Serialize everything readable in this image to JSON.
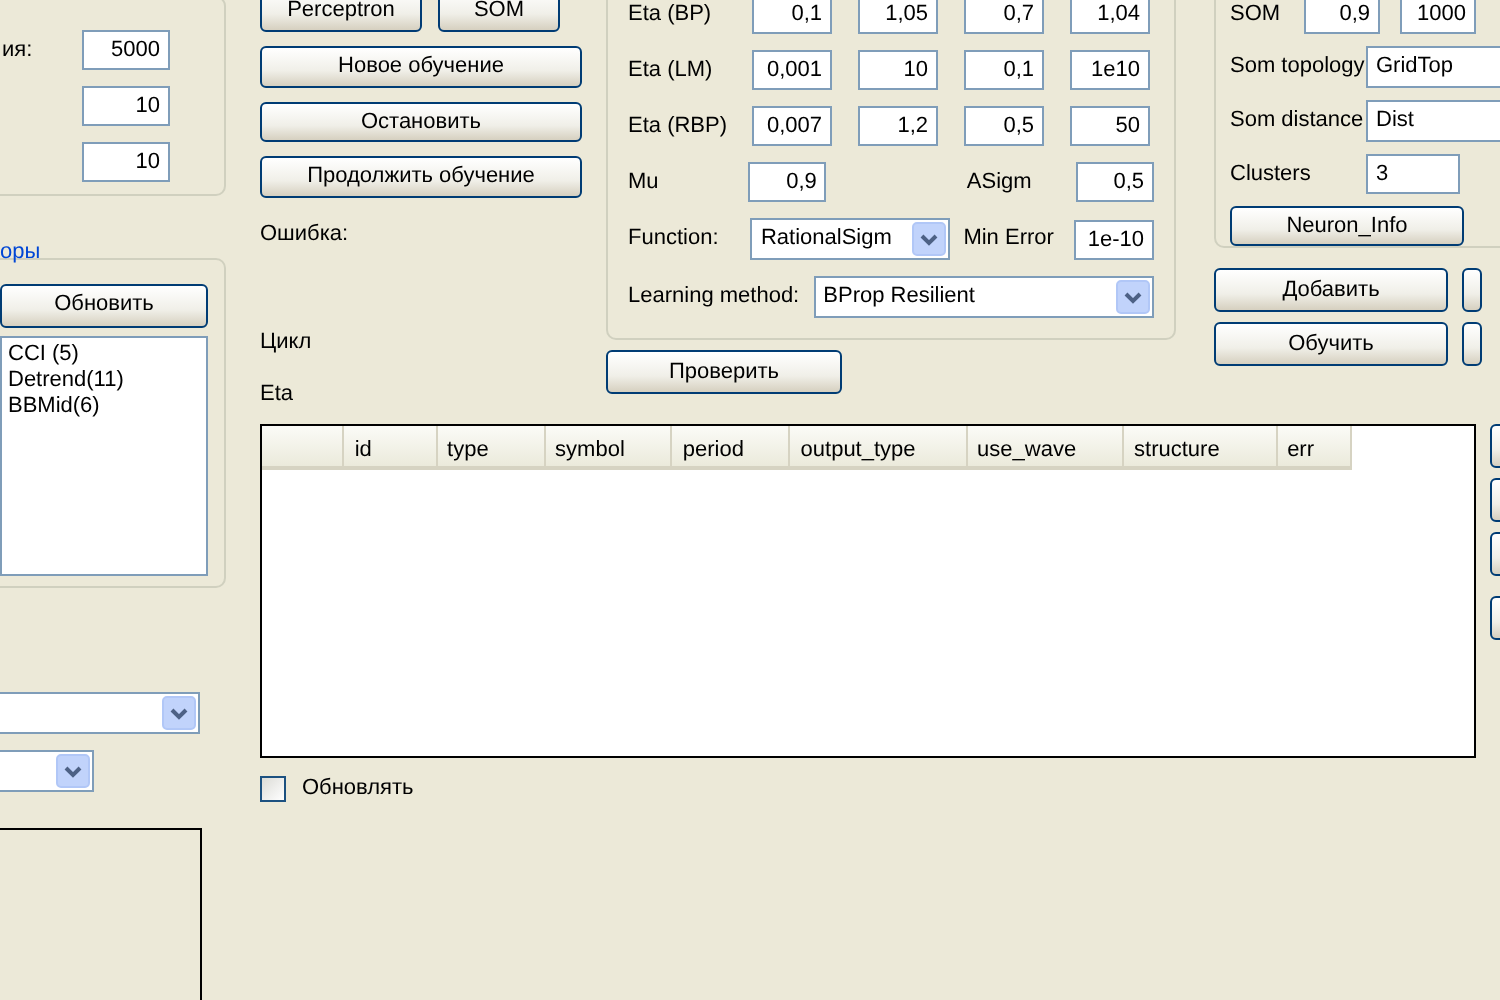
{
  "left_panel": {
    "fields": [
      {
        "label": "ия:",
        "value": "5000"
      },
      {
        "value": "10"
      },
      {
        "value": "10"
      }
    ],
    "indicators_group": {
      "title": "оры",
      "refresh_button": "Обновить",
      "items": [
        "CCI (5)",
        "Detrend(11)",
        "BBMid(6)"
      ]
    }
  },
  "model_buttons": [
    "Perceptron",
    "SOM"
  ],
  "training_buttons": [
    "Новое обучение",
    "Остановить",
    "Продолжить обучение"
  ],
  "status_labels": [
    "Ошибка:",
    "Цикл",
    "Eta"
  ],
  "params": {
    "rows": [
      {
        "label": "Eta (BP)",
        "values": [
          "0,1",
          "1,05",
          "0,7",
          "1,04"
        ]
      },
      {
        "label": "Eta (LM)",
        "values": [
          "0,001",
          "10",
          "0,1",
          "1e10"
        ]
      },
      {
        "label": "Eta (RBP)",
        "values": [
          "0,007",
          "1,2",
          "0,5",
          "50"
        ]
      }
    ],
    "mu": {
      "label": "Mu",
      "value": "0,9"
    },
    "asigm": {
      "label": "ASigm",
      "value": "0,5"
    },
    "function": {
      "label": "Function:",
      "value": "RationalSigm"
    },
    "min_error": {
      "label": "Min Error",
      "value": "1e-10"
    },
    "learning_method": {
      "label": "Learning method:",
      "value": "BProp Resilient"
    }
  },
  "check_button": "Проверить",
  "som": {
    "label": "SOM",
    "values": [
      "0,9",
      "1000"
    ],
    "topology": {
      "label": "Som topology",
      "value": "GridTop"
    },
    "distance": {
      "label": "Som distance",
      "value": "Dist"
    },
    "clusters": {
      "label": "Clusters",
      "value": "3"
    },
    "info_button": "Neuron_Info"
  },
  "action_buttons": [
    "Добавить",
    "Обучить"
  ],
  "table": {
    "columns": [
      "id",
      "type",
      "symbol",
      "period",
      "output_type",
      "use_wave",
      "structure",
      "err"
    ]
  },
  "auto_update": {
    "label": "Обновлять",
    "checked": false
  }
}
